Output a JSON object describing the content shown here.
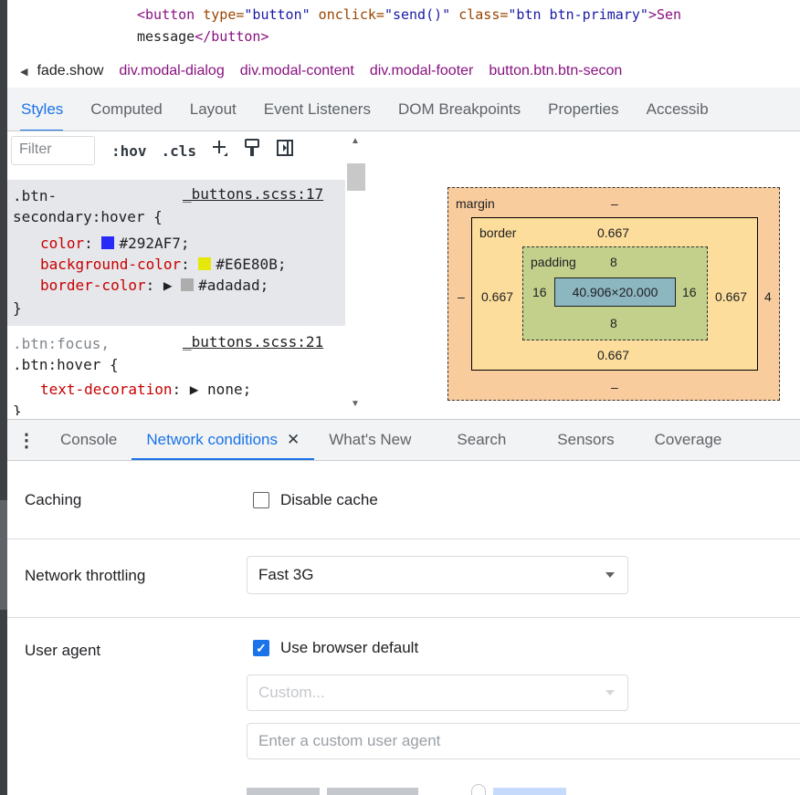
{
  "source": {
    "line1_tag_open": "<button",
    "line1_attr1": " type=",
    "line1_val1": "\"button\"",
    "line1_attr2": " onclick=",
    "line1_val2": "\"send()\"",
    "line1_attr3": " class=",
    "line1_val3": "\"btn btn-primary\"",
    "line1_tail": ">Sen",
    "line2_text": "message",
    "line2_tag_close": "</button>"
  },
  "breadcrumb": {
    "items": [
      "fade.show",
      "div.modal-dialog",
      "div.modal-content",
      "div.modal-footer",
      "button.btn.btn-secon"
    ]
  },
  "styles_tabs": [
    "Styles",
    "Computed",
    "Layout",
    "Event Listeners",
    "DOM Breakpoints",
    "Properties",
    "Accessib"
  ],
  "styles_active_tab": "Styles",
  "filter": {
    "placeholder": "Filter",
    "hov": ":hov",
    "cls": ".cls"
  },
  "rules": [
    {
      "selector_line1": ".btn-",
      "selector_line2": "secondary:hover {",
      "source": "_buttons.scss:17",
      "declarations": [
        {
          "prop": "color",
          "value": "#292AF7",
          "swatch": "#292AF7"
        },
        {
          "prop": "background-color",
          "value": "#E6E80B",
          "swatch": "#E6E80B"
        },
        {
          "prop": "border-color",
          "value": "#adadad",
          "swatch": "#adadad"
        }
      ],
      "close": "}"
    },
    {
      "selector_line1": ".btn:focus,",
      "selector_line2": ".btn:hover {",
      "source": "_buttons.scss:21",
      "declarations": [
        {
          "prop": "text-decoration",
          "value": "none"
        }
      ],
      "close": "}"
    }
  ],
  "box_model": {
    "margin_label": "margin",
    "margin_top": "–",
    "margin_bottom": "–",
    "margin_left": "–",
    "margin_right": "4",
    "border_label": "border",
    "border_top": "0.667",
    "border_bottom": "0.667",
    "border_left": "0.667",
    "border_right": "0.667",
    "padding_label": "padding",
    "padding_top": "8",
    "padding_bottom": "8",
    "padding_left": "16",
    "padding_right": "16",
    "content": "40.906×20.000"
  },
  "drawer_tabs": [
    "Console",
    "Network conditions",
    "What's New",
    "Search",
    "Sensors",
    "Coverage"
  ],
  "drawer_active_tab": "Network conditions",
  "network_conditions": {
    "caching_label": "Caching",
    "disable_cache_label": "Disable cache",
    "disable_cache_checked": false,
    "throttling_label": "Network throttling",
    "throttling_value": "Fast 3G",
    "user_agent_label": "User agent",
    "use_default_label": "Use browser default",
    "use_default_checked": true,
    "custom_select": "Custom...",
    "custom_ua_placeholder": "Enter a custom user agent"
  },
  "colors": {
    "accent": "#1a73e8",
    "tag": "#881280",
    "attr": "#994500",
    "attr_value": "#1a1aa6",
    "css_property": "#c80000"
  }
}
